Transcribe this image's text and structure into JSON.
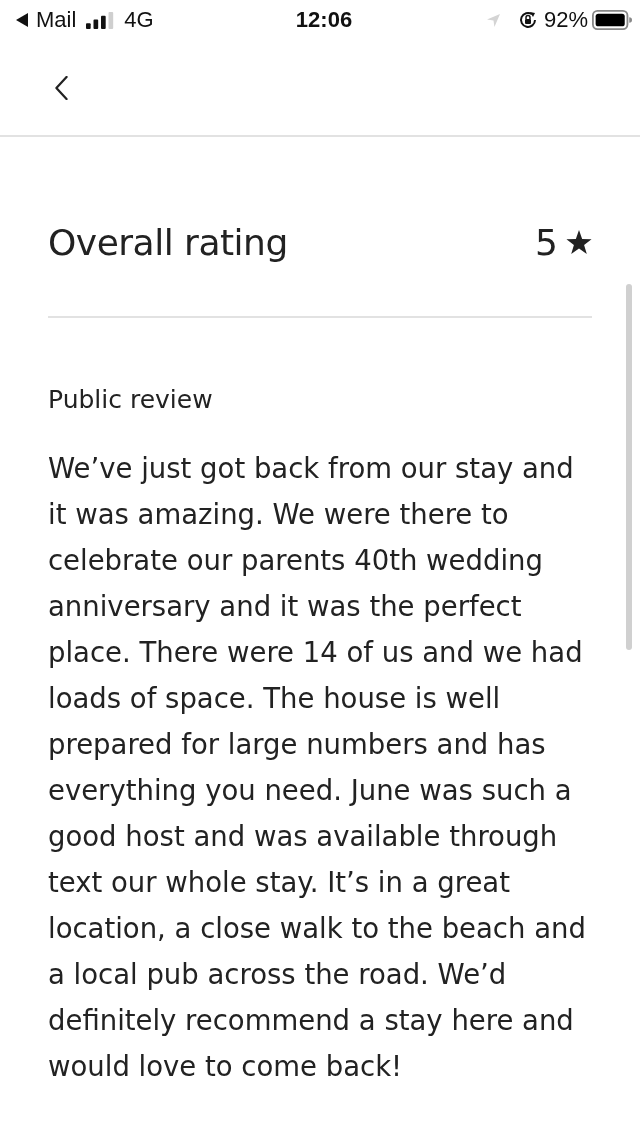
{
  "status_bar": {
    "back_app": "Mail",
    "network": "4G",
    "time": "12:06",
    "battery": "92%"
  },
  "rating": {
    "title": "Overall rating",
    "value": "5"
  },
  "review": {
    "heading": "Public review",
    "text": "We’ve just got back from our stay and it was amazing. We were there to celebrate our parents 40th wedding anniversary and it was the perfect place. There were 14 of us and we had loads of space. The house is well prepared for large numbers and has everything you need. June was such a good host and was available through text our whole stay. It’s in a great location, a close walk to the beach and a local pub across the road. We’d definitely recommend a stay here and would love to come back!"
  }
}
